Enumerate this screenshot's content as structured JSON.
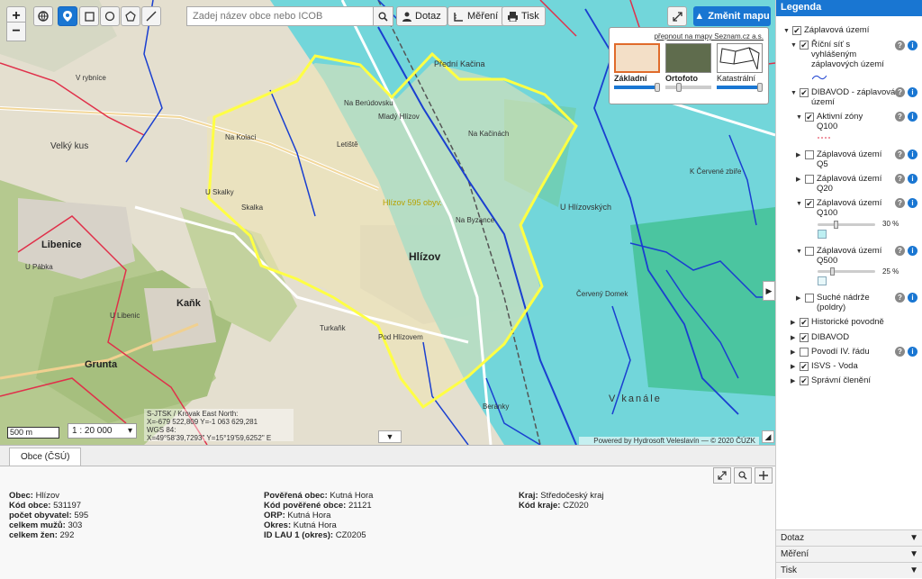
{
  "toolbar": {
    "search_placeholder": "Zadej název obce nebo ICOB",
    "dotaz_label": "Dotaz",
    "mereni_label": "Měření",
    "tisk_label": "Tisk",
    "zmenit_mapu_label": "Změnit mapu"
  },
  "basemap": {
    "switch_link": "přepnout na mapy Seznam.cz a.s.",
    "options": [
      "Základní",
      "Ortofoto",
      "Katastrální"
    ],
    "selected": "Základní"
  },
  "map": {
    "scale_bar": "500 m",
    "scale_select": "1 : 20 000",
    "coords": [
      "S-JTSK / Krovak East North:",
      "X=-679 522,809 Y=-1 063 629,281",
      "WGS 84:",
      "X=49°58'39,7293\" Y=15°19'59,6252\" E"
    ],
    "copyright": "Powered by Hydrosoft Veleslavín — © 2020 ČÚZK",
    "place_labels": [
      "Hlízov",
      "Libenice",
      "Kaňk",
      "Grunta",
      "Přední Kačina",
      "U Hlízovských",
      "V kanále",
      "Velký kus",
      "U Skalky",
      "Skalka",
      "Turkaňk",
      "Pod Hlízovem",
      "Beránky",
      "Na Berúdovsku",
      "Mladý Hlízov",
      "Na Kačinách",
      "Na Byzance",
      "U Libenic",
      "U Pábka",
      "Červený Domek",
      "Letiště",
      "Na Kolaci",
      "K Červené zbiře",
      "V rybníce",
      "Hlízov 595 obyv."
    ]
  },
  "panel": {
    "tab": "Obce (ČSÚ)",
    "col1": [
      {
        "k": "Obec",
        "v": "Hlízov"
      },
      {
        "k": "Kód obce",
        "v": "531197"
      },
      {
        "k": "počet obyvatel",
        "v": "595"
      },
      {
        "k": "celkem mužů",
        "v": "303"
      },
      {
        "k": "celkem žen",
        "v": "292"
      }
    ],
    "col2": [
      {
        "k": "Pověřená obec",
        "v": "Kutná Hora"
      },
      {
        "k": "Kód pověřené obce",
        "v": "21121"
      },
      {
        "k": "ORP",
        "v": "Kutná Hora"
      },
      {
        "k": "Okres",
        "v": "Kutná Hora"
      },
      {
        "k": "ID LAU 1 (okres)",
        "v": "CZ0205"
      }
    ],
    "col3": [
      {
        "k": "Kraj",
        "v": "Středočeský kraj"
      },
      {
        "k": "Kód kraje",
        "v": "CZ020"
      }
    ]
  },
  "legend": {
    "title": "Legenda",
    "items": {
      "zaplavova_uzemi": "Záplavová území",
      "ricni_sit": "Říční síť s vyhlášeným záplavových území",
      "dibavod_zap": "DIBAVOD - záplavová území",
      "aktivni_zony": "Aktivní zóny Q100",
      "zap_q5": "Záplavová území Q5",
      "zap_q20": "Záplavová území Q20",
      "zap_q100": "Záplavová území Q100",
      "zap_q100_pct": "30 %",
      "zap_q500": "Záplavová území Q500",
      "zap_q500_pct": "25 %",
      "suche_nadrze": "Suché nádrže (poldry)",
      "historicke": "Historické povodně",
      "dibavod": "DIBAVOD",
      "povodi": "Povodí IV. řádu",
      "isvs": "ISVS - Voda",
      "spravni": "Správní členění"
    },
    "bottom": [
      "Dotaz",
      "Měření",
      "Tisk"
    ]
  },
  "colors": {
    "accent": "#1976d2",
    "flood": "#4fd4d8",
    "boundary": "#ffff44",
    "river": "#1a3fd0",
    "district": "#e0304a"
  }
}
